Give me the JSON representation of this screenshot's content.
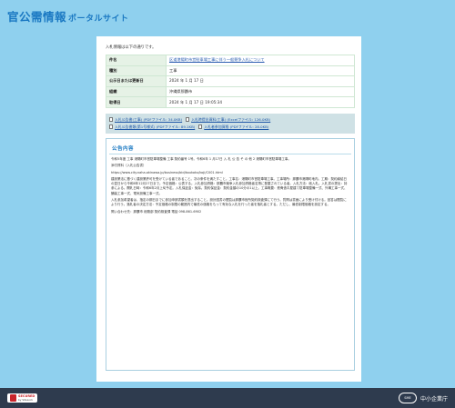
{
  "header": {
    "site_title": "官公需情報",
    "site_subtitle": "ポータルサイト"
  },
  "intro": "入札情報は以下の通りです。",
  "info_rows": [
    {
      "label": "件名",
      "value": "区道港陽町市営駐車場工事に伴う一般競争入札について",
      "is_link": true
    },
    {
      "label": "種別",
      "value": "工事",
      "is_link": false
    },
    {
      "label": "公示日または更新日",
      "value": "2024 年 1 月 17 日",
      "is_link": false
    },
    {
      "label": "組織",
      "value": "沖縄県那覇市",
      "is_link": false
    },
    {
      "label": "取得日",
      "value": "2024 年 1 月 17 日 19:05:34",
      "is_link": false
    }
  ],
  "attachments": [
    {
      "label": "入札公告書(工事) (PDFファイル: 34.0KB)"
    },
    {
      "label": "入札時提出資料(工事) (Excelファイル: 126.0KB)"
    },
    {
      "label": "入札公告書類(第1号様式) (PDFファイル: 89.1KB)"
    },
    {
      "label": "入札者参加資格 (PDFファイル: 28.0KB)"
    }
  ],
  "section_title": "公告内容",
  "body_paragraphs": [
    "令和5年度 工事 港陽町市営駐車場整備 工事 契約番号 1号。令和6年 1 月17日 入 札 公 告 そ の 他 2 港陽町市営駐車場工事。",
    "添付資料（入札公告書）",
    "https://www.city.naha.okinawa.jp/business/bid/koukoku/koji/C001.html",
    "建設業法に基づく建設業許可を受けている者であること。次の条件を満たすこと。工事名：港陽町市営駐車場工事。工事場所：那覇市港陽町地内。工期：契約締結日の翌日から令和6年12月27日まで。予定価格：公表する。入札参加資格：那覇市競争入札参加資格者名簿に登載されている者。入札方法：紙入札。入札書の提出：持参による。開札日時：令和6年2月上旬予定。入札保証金：免除。契約保証金：契約金額の10分の1以上。工事概要：鉄骨造平屋建て駐車場整備一式、外構工事一式、舗装工事一式、電気設備工事一式。",
    "入札参加希望者は、指定の期日までに参加申請書類を提出すること。設計図書の閲覧は那覇市役所契約検査課にて行う。質問は書面により受け付ける。回答は閲覧により行う。落札者の決定方法：予定価格の制限の範囲内で最低の価格をもって有効な入札を行った者を落札者とする。ただし、最低制限価格を設定する。",
    "問い合わせ先：那覇市 総務部 契約検査課 電話 098-861-6902"
  ],
  "footer": {
    "secured_label": "SECURED",
    "secured_by": "by SiteLock",
    "org_name": "中小企業庁",
    "org_mark": "SME"
  }
}
